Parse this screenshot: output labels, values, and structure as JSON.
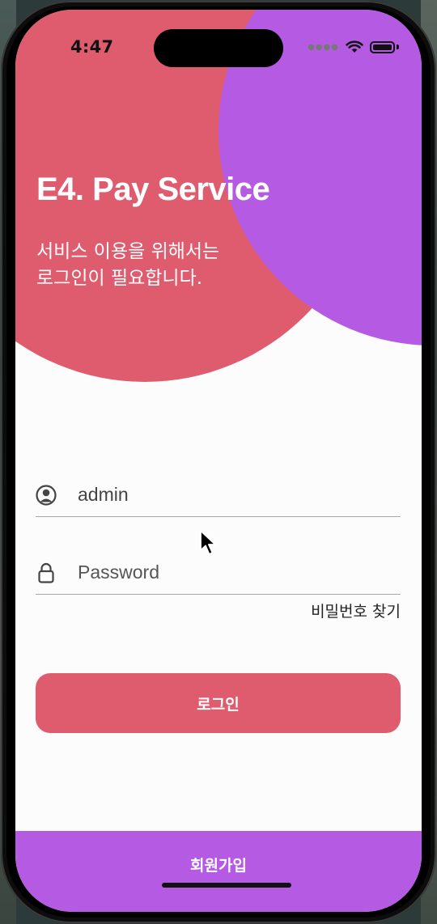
{
  "status_bar": {
    "time": "4:47",
    "signal_icon": "signal-dots-icon",
    "wifi_icon": "wifi-icon",
    "battery_icon": "battery-icon"
  },
  "hero": {
    "title": "E4. Pay Service",
    "subtitle": "서비스 이용을 위해서는\n로그인이 필요합니다."
  },
  "login_form": {
    "username": {
      "icon": "user-circle-icon",
      "value": "admin",
      "placeholder": ""
    },
    "password": {
      "icon": "lock-icon",
      "value": "",
      "placeholder": "Password"
    },
    "find_password_label": "비밀번호 찾기",
    "login_button_label": "로그인"
  },
  "footer": {
    "signup_label": "회원가입"
  },
  "colors": {
    "primary_red": "#df5c6e",
    "accent_purple": "#b55ae3",
    "background": "#fcfcfc"
  }
}
